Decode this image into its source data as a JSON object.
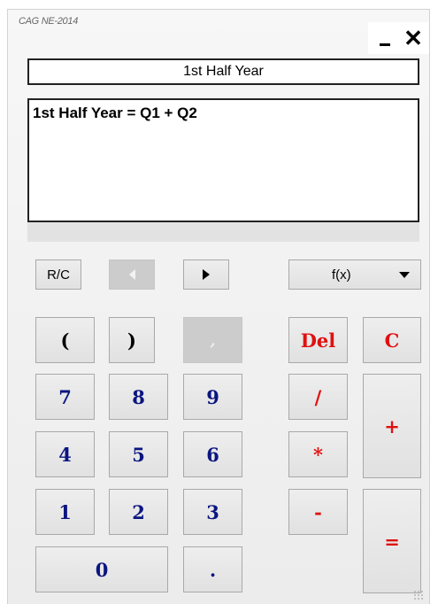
{
  "window": {
    "title": "CAG NE-2014",
    "close_label": "✕",
    "minimize_icon": "minimize-icon",
    "resize_icon": "resize-grip-icon"
  },
  "name_field": {
    "value": "1st Half Year"
  },
  "formula_field": {
    "value": "1st Half Year = Q1 + Q2"
  },
  "controls": {
    "rc_label": "R/C",
    "prev_icon": "arrow-left-icon",
    "next_icon": "arrow-right-icon",
    "fx_label": "f(x)",
    "fx_dropdown_icon": "chevron-down-icon"
  },
  "keys": {
    "open_paren": "(",
    "close_paren": ")",
    "comma": ",",
    "del": "Del",
    "clear": "C",
    "seven": "7",
    "eight": "8",
    "nine": "9",
    "four": "4",
    "five": "5",
    "six": "6",
    "one": "1",
    "two": "2",
    "three": "3",
    "zero": "0",
    "dot": ".",
    "divide": "/",
    "multiply": "*",
    "minus": "-",
    "plus": "+",
    "equals": "="
  },
  "colors": {
    "digit_color": "#0b1580",
    "operator_color": "#e01010",
    "disabled_bg": "#cccccc"
  }
}
